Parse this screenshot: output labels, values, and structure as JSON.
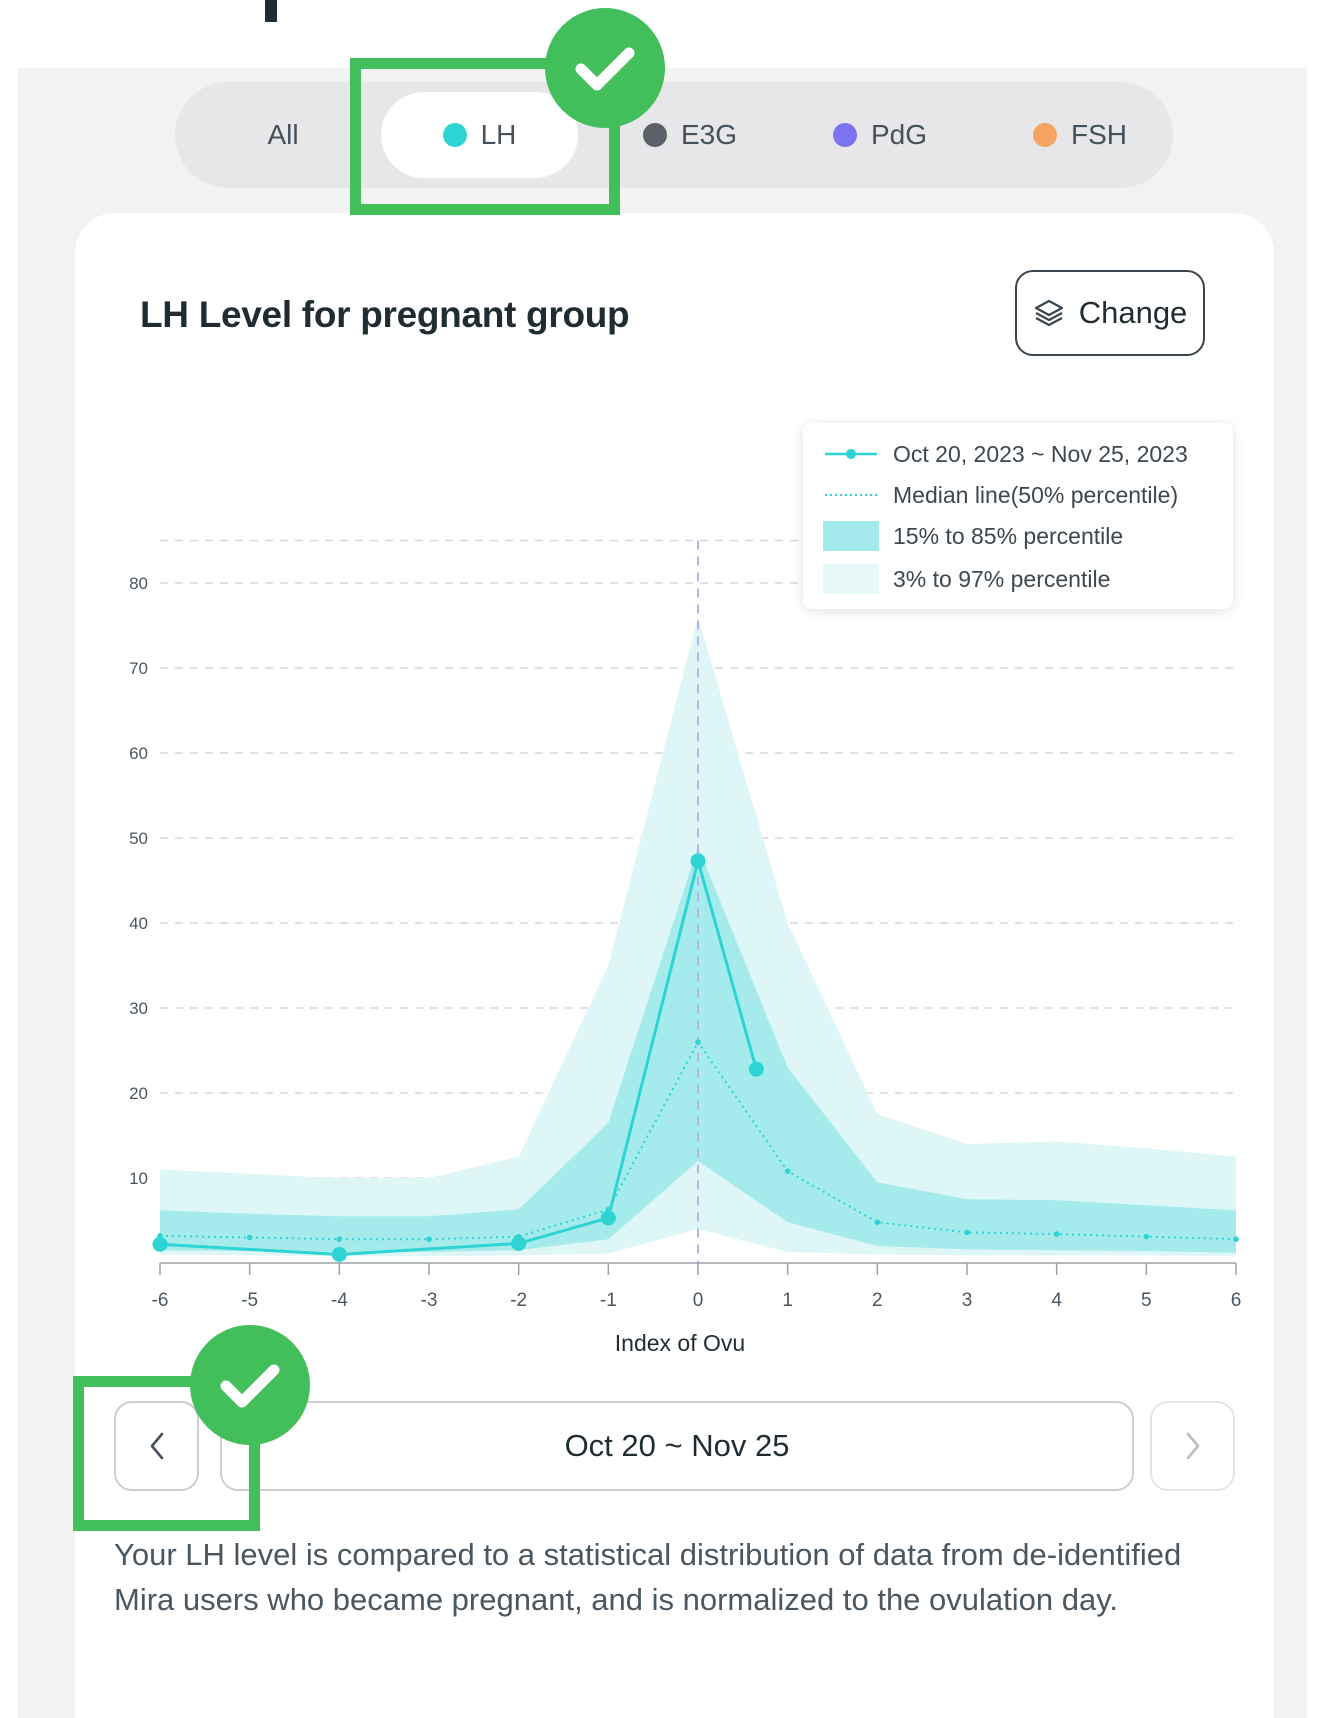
{
  "tabs": [
    {
      "label": "All",
      "color": null,
      "active": false
    },
    {
      "label": "LH",
      "color": "#2ed3d3",
      "active": true
    },
    {
      "label": "E3G",
      "color": "#5c6169",
      "active": false
    },
    {
      "label": "PdG",
      "color": "#7b74ef",
      "active": false
    },
    {
      "label": "FSH",
      "color": "#f5a561",
      "active": false
    }
  ],
  "chart_title": "LH Level for pregnant group",
  "change_button": {
    "label": "Change",
    "icon": "layers-icon"
  },
  "legend": [
    {
      "label": "Oct 20, 2023 ~ Nov 25, 2023",
      "kind": "line-with-dot"
    },
    {
      "label": "Median line(50% percentile)",
      "kind": "dotted-line"
    },
    {
      "label": "15% to 85% percentile",
      "kind": "band-dark"
    },
    {
      "label": "3% to 97% percentile",
      "kind": "band-light"
    }
  ],
  "nav": {
    "range_label": "Oct 20 ~ Nov 25",
    "prev_icon": "chevron-left-icon",
    "next_icon": "chevron-right-icon"
  },
  "description": "Your LH level is compared to a statistical distribution of data from de-identified Mira users who became pregnant, and is normalized to the ovulation day.",
  "colors": {
    "accent": "#2ed3d3",
    "band_dark": "#a6ebeb",
    "band_light": "#dff6f6",
    "highlight": "#42be5b"
  },
  "chart_data": {
    "type": "line",
    "xlabel": "Index of Ovu",
    "ylabel": "",
    "x": [
      -6,
      -5,
      -4,
      -3,
      -2,
      -1,
      0,
      1,
      2,
      3,
      4,
      5,
      6
    ],
    "ylim": [
      0,
      85
    ],
    "yticks": [
      10,
      20,
      30,
      40,
      50,
      60,
      70,
      80
    ],
    "grid": true,
    "legend_position": "top-right",
    "series": [
      {
        "name": "Oct 20, 2023 ~ Nov 25, 2023",
        "points": [
          [
            -6,
            2.2
          ],
          [
            -4,
            1.0
          ],
          [
            -2,
            2.3
          ],
          [
            -1,
            5.3
          ],
          [
            0,
            47.3
          ],
          [
            0.65,
            22.8
          ]
        ]
      },
      {
        "name": "Median line(50% percentile)",
        "points": [
          [
            -6,
            3.2
          ],
          [
            -5,
            3.0
          ],
          [
            -4,
            2.8
          ],
          [
            -3,
            2.8
          ],
          [
            -2,
            3.1
          ],
          [
            -1,
            6.3
          ],
          [
            0,
            26.0
          ],
          [
            1,
            10.8
          ],
          [
            2,
            4.8
          ],
          [
            3,
            3.6
          ],
          [
            4,
            3.4
          ],
          [
            5,
            3.1
          ],
          [
            6,
            2.8
          ]
        ]
      }
    ],
    "bands": [
      {
        "name": "3% to 97% percentile",
        "lower": [
          1.0,
          0.9,
          0.8,
          0.8,
          0.9,
          1.1,
          4.0,
          1.3,
          1.0,
          0.9,
          0.9,
          0.9,
          0.8
        ],
        "upper": [
          11.0,
          10.5,
          10.0,
          10.0,
          12.5,
          35.0,
          76.0,
          40.0,
          17.5,
          14.0,
          14.3,
          13.5,
          12.5
        ]
      },
      {
        "name": "15% to 85% percentile",
        "lower": [
          1.5,
          1.4,
          1.3,
          1.3,
          1.5,
          2.8,
          12.0,
          4.8,
          2.0,
          1.6,
          1.5,
          1.4,
          1.2
        ],
        "upper": [
          6.2,
          5.8,
          5.5,
          5.5,
          6.3,
          16.5,
          49.0,
          23.0,
          9.5,
          7.5,
          7.4,
          6.8,
          6.2
        ]
      }
    ]
  }
}
